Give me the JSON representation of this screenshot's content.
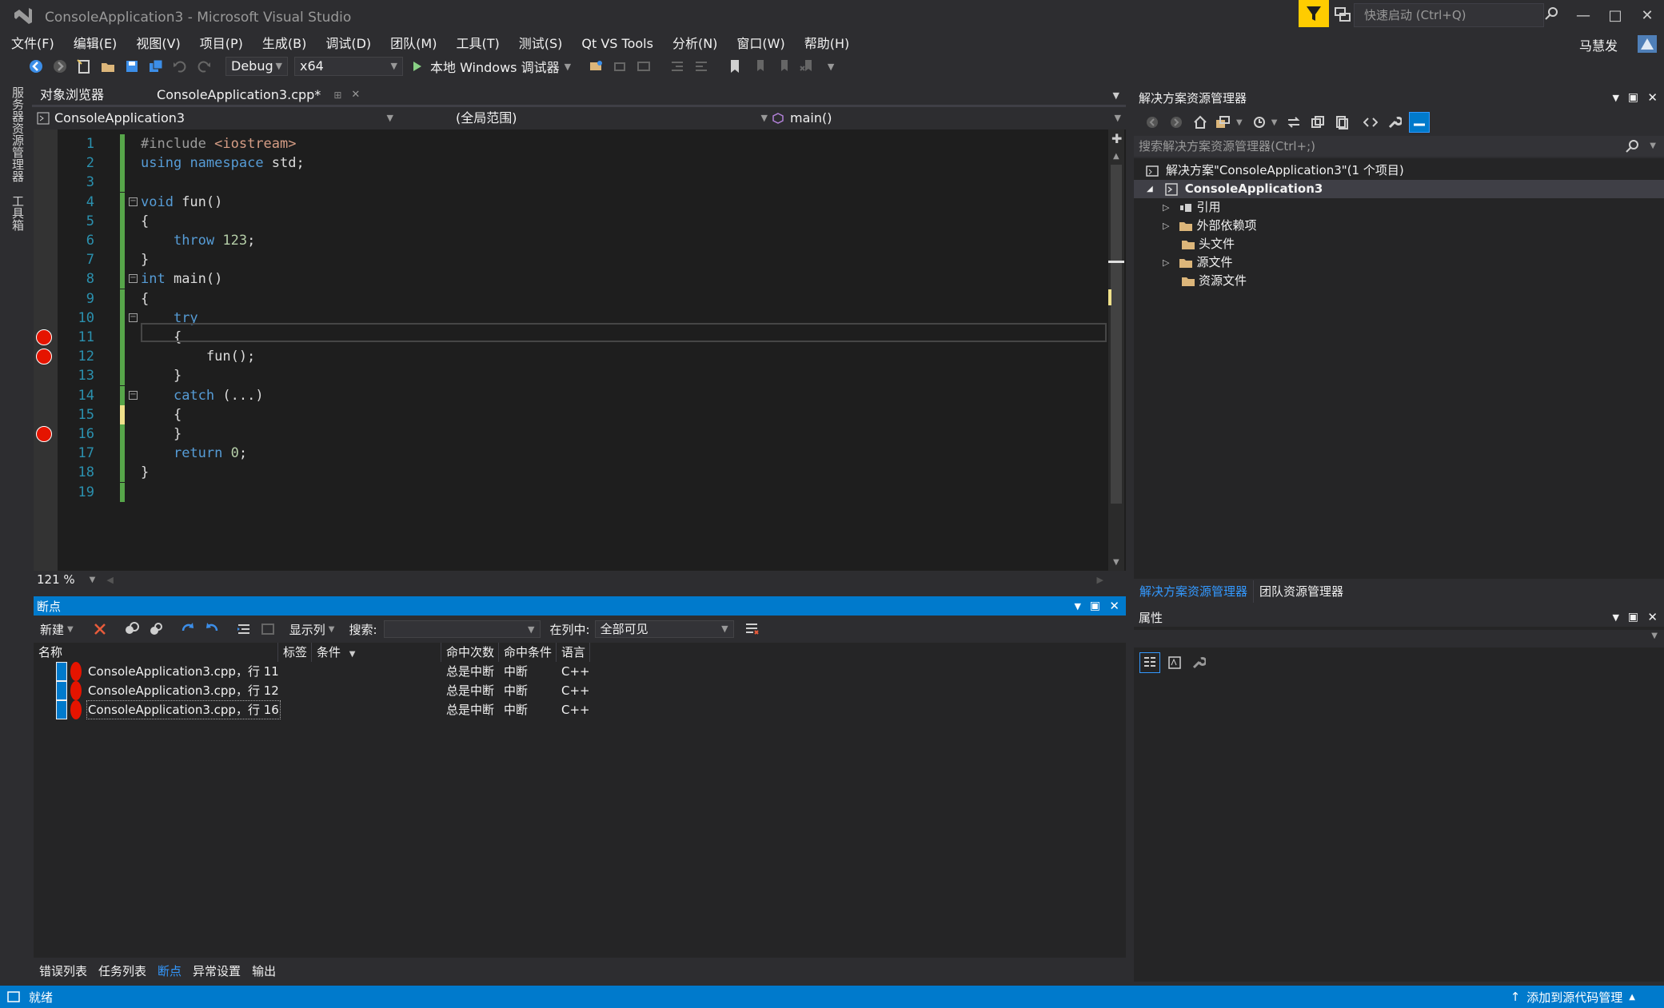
{
  "window": {
    "title": "ConsoleApplication3 - Microsoft Visual Studio",
    "quick_launch_placeholder": "快速启动 (Ctrl+Q)",
    "user": "马慧发",
    "accent": "#007acc"
  },
  "menu": [
    "文件(F)",
    "编辑(E)",
    "视图(V)",
    "项目(P)",
    "生成(B)",
    "调试(D)",
    "团队(M)",
    "工具(T)",
    "测试(S)",
    "Qt VS Tools",
    "分析(N)",
    "窗口(W)",
    "帮助(H)"
  ],
  "toolbar": {
    "config": "Debug",
    "platform": "x64",
    "run_label": "本地 Windows 调试器"
  },
  "left_strip": [
    "服务器资源管理器",
    "工具箱"
  ],
  "doc_tabs": [
    {
      "label": "对象浏览器",
      "active": false
    },
    {
      "label": "ConsoleApplication3.cpp*",
      "active": true
    }
  ],
  "nav": {
    "project": "ConsoleApplication3",
    "scope": "(全局范围)",
    "member": "main()"
  },
  "editor": {
    "zoom": "121 %",
    "lines": [
      {
        "n": "1",
        "code": "#include <iostream>",
        "bp": false,
        "change": "green"
      },
      {
        "n": "2",
        "code": "using namespace std;",
        "bp": false,
        "change": "green"
      },
      {
        "n": "3",
        "code": "",
        "bp": false,
        "change": "green"
      },
      {
        "n": "4",
        "code": "void fun()",
        "bp": false,
        "change": "green",
        "fold": true
      },
      {
        "n": "5",
        "code": "{",
        "bp": false,
        "change": "green"
      },
      {
        "n": "6",
        "code": "    throw 123;",
        "bp": false,
        "change": "green"
      },
      {
        "n": "7",
        "code": "}",
        "bp": false,
        "change": "green"
      },
      {
        "n": "8",
        "code": "int main()",
        "bp": false,
        "change": "green",
        "fold": true
      },
      {
        "n": "9",
        "code": "{",
        "bp": false,
        "change": "green"
      },
      {
        "n": "10",
        "code": "    try",
        "bp": false,
        "change": "green",
        "fold": true
      },
      {
        "n": "11",
        "code": "    {",
        "bp": true,
        "change": "green"
      },
      {
        "n": "12",
        "code": "        fun();",
        "bp": true,
        "change": "green"
      },
      {
        "n": "13",
        "code": "    }",
        "bp": false,
        "change": "green"
      },
      {
        "n": "14",
        "code": "    catch (...)",
        "bp": false,
        "change": "green",
        "fold": true
      },
      {
        "n": "15",
        "code": "    {",
        "bp": false,
        "change": "yellow"
      },
      {
        "n": "16",
        "code": "    }",
        "bp": true,
        "change": "green"
      },
      {
        "n": "17",
        "code": "    return 0;",
        "bp": false,
        "change": "green"
      },
      {
        "n": "18",
        "code": "}",
        "bp": false,
        "change": "green"
      },
      {
        "n": "19",
        "code": "",
        "bp": false,
        "change": "green"
      }
    ]
  },
  "breakpoints_panel": {
    "title": "断点",
    "new_label": "新建",
    "columns_label": "显示列",
    "search_label": "搜索:",
    "in_column_label": "在列中:",
    "in_column_value": "全部可见",
    "headers": [
      "名称",
      "标签",
      "条件",
      "命中次数",
      "命中条件",
      "语言"
    ],
    "rows": [
      {
        "name": "ConsoleApplication3.cpp，行 11",
        "hit_count": "总是中断",
        "hit_condition": "中断",
        "language": "C++"
      },
      {
        "name": "ConsoleApplication3.cpp，行 12",
        "hit_count": "总是中断",
        "hit_condition": "中断",
        "language": "C++"
      },
      {
        "name": "ConsoleApplication3.cpp，行 16",
        "hit_count": "总是中断",
        "hit_condition": "中断",
        "language": "C++"
      }
    ]
  },
  "bottom_tabs": [
    {
      "label": "错误列表",
      "active": false
    },
    {
      "label": "任务列表",
      "active": false
    },
    {
      "label": "断点",
      "active": true
    },
    {
      "label": "异常设置",
      "active": false
    },
    {
      "label": "输出",
      "active": false
    }
  ],
  "solution_explorer": {
    "title": "解决方案资源管理器",
    "search_placeholder": "搜索解决方案资源管理器(Ctrl+;)",
    "solution": "解决方案\"ConsoleApplication3\"(1 个项目)",
    "project": "ConsoleApplication3",
    "items": [
      {
        "label": "引用",
        "expandable": true
      },
      {
        "label": "外部依赖项",
        "expandable": true
      },
      {
        "label": "头文件",
        "expandable": false
      },
      {
        "label": "源文件",
        "expandable": true
      },
      {
        "label": "资源文件",
        "expandable": false
      }
    ],
    "tabs": [
      {
        "label": "解决方案资源管理器",
        "active": true
      },
      {
        "label": "团队资源管理器",
        "active": false
      }
    ]
  },
  "properties": {
    "title": "属性"
  },
  "status": {
    "text": "就绪",
    "source_control": "添加到源代码管理"
  }
}
